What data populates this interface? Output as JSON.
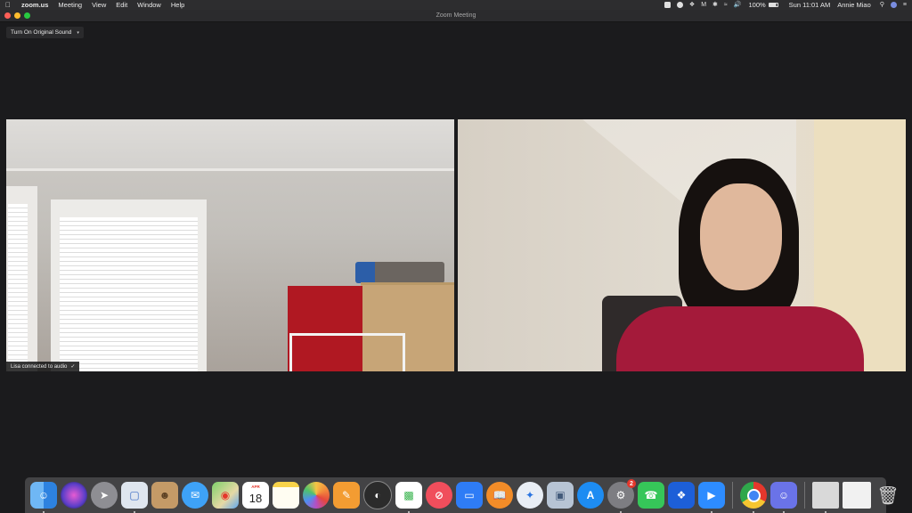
{
  "menubar": {
    "app_name": "zoom.us",
    "menus": [
      "Meeting",
      "View",
      "Edit",
      "Window",
      "Help"
    ],
    "battery": "100%",
    "clock": "Sun 11:01 AM",
    "user": "Annie Miao"
  },
  "window": {
    "title": "Zoom Meeting"
  },
  "meeting": {
    "sound_button": "Turn On Original Sound",
    "left_tile_status": "Lisa connected to audio",
    "check_glyph": "✓"
  },
  "dock": {
    "calendar_month": "APR",
    "calendar_day": "18",
    "system_prefs_badge": "2"
  }
}
